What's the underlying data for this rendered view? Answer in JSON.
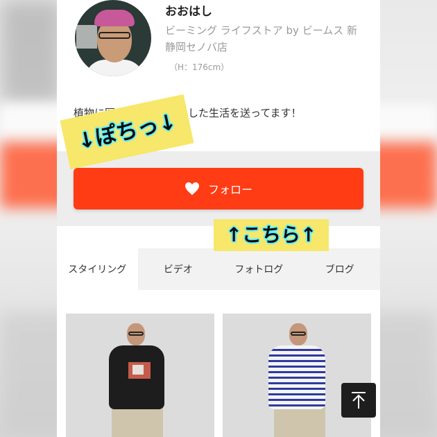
{
  "profile": {
    "name": "おおはし",
    "shop": "ビーミング ライフストア by ビームス 新静岡セノバ店",
    "height": "（H：176cm）",
    "bio": "植物に囲まれたゆったりした生活を送ってます！"
  },
  "follow": {
    "label": "フォロー",
    "icon": "heart-icon"
  },
  "tabs": [
    {
      "label": "スタイリング",
      "active": true
    },
    {
      "label": "ビデオ",
      "active": false
    },
    {
      "label": "フォトログ",
      "active": false
    },
    {
      "label": "ブログ",
      "active": false
    }
  ],
  "annotations": {
    "top": "↓ぽちっ↓",
    "bottom": "↑こちら↑"
  },
  "colors": {
    "accent": "#ff3c14",
    "sticker": "#f7e76a",
    "sticker_outline": "#5df0ff"
  },
  "icons": {
    "scroll_top": "arrow-up-to-top-icon"
  }
}
